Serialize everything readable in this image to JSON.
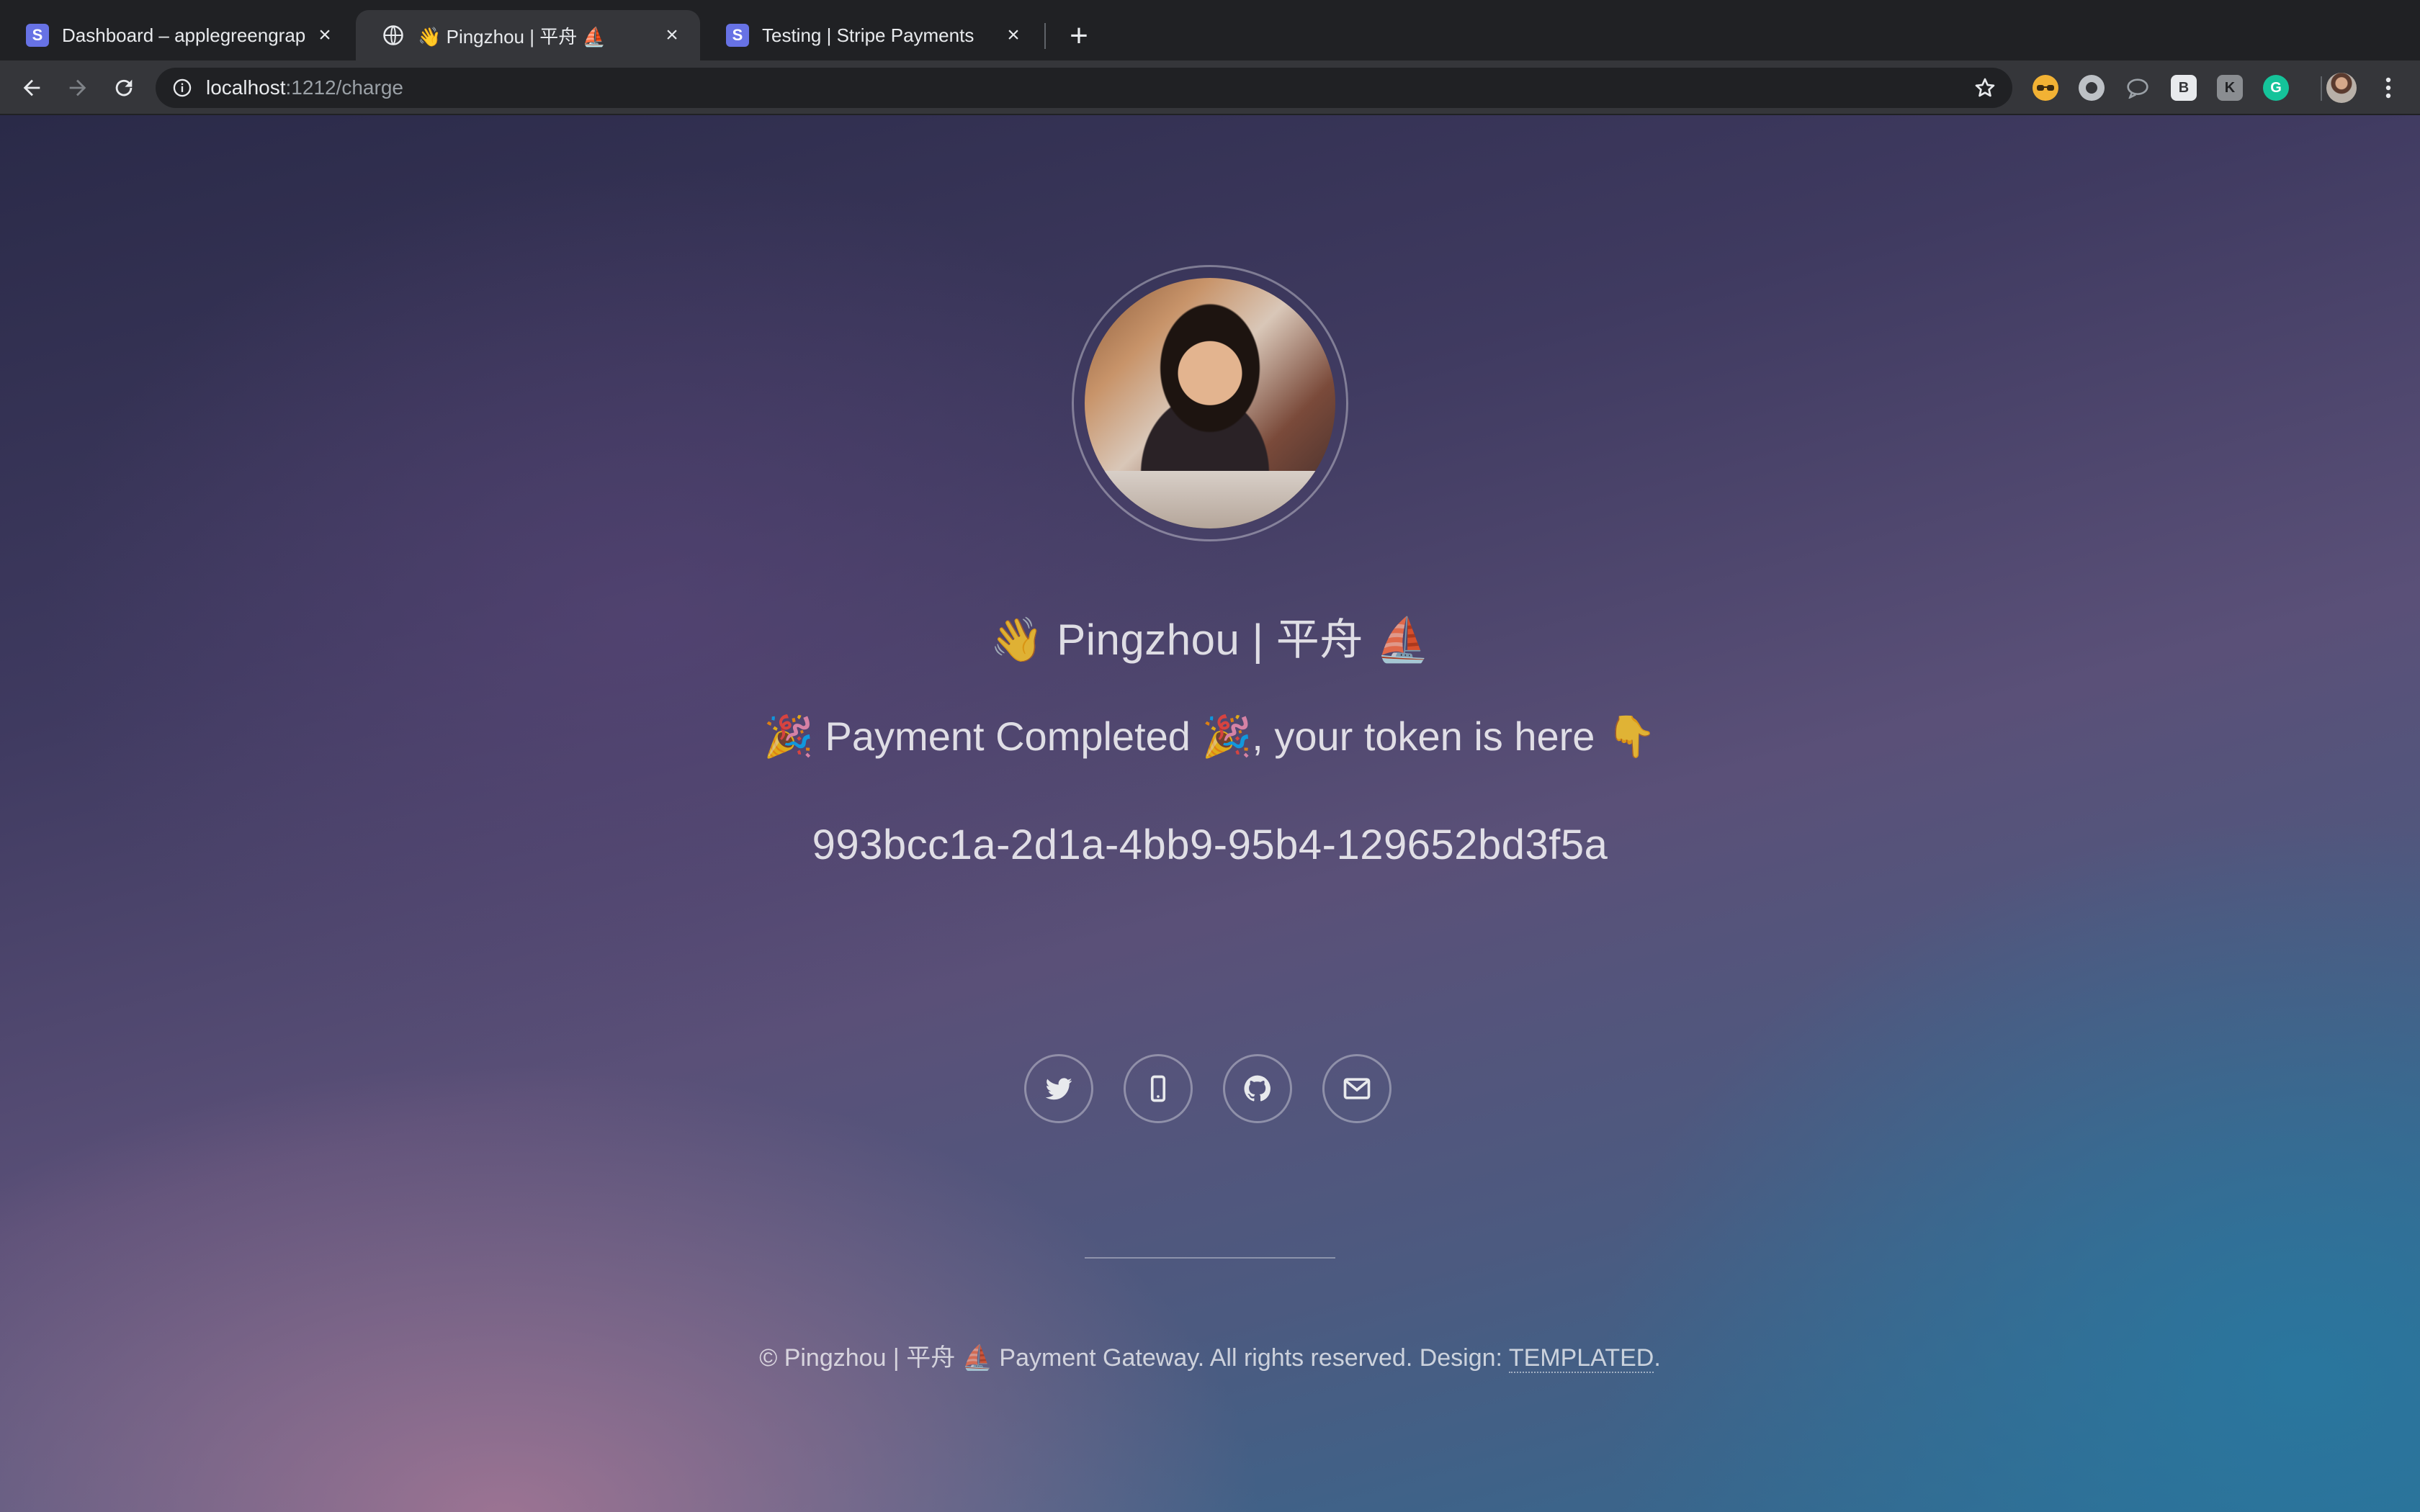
{
  "browser": {
    "tabs": [
      {
        "title": "Dashboard – applegreengrape",
        "icon": "stripe-icon",
        "active": false
      },
      {
        "title": "👋 Pingzhou | 平舟 ⛵",
        "icon": "globe-icon",
        "active": true
      },
      {
        "title": "Testing | Stripe Payments",
        "icon": "stripe-icon",
        "active": false
      }
    ],
    "new_tab": "+",
    "url": {
      "host": "localhost",
      "path": ":1212/charge"
    }
  },
  "page": {
    "title": "👋 Pingzhou | 平舟 ⛵",
    "message": "🎉 Payment Completed 🎉, your token is here 👇",
    "token": "993bcc1a-2d1a-4bb9-95b4-129652bd3f5a",
    "social": [
      {
        "name": "twitter-icon"
      },
      {
        "name": "phone-icon"
      },
      {
        "name": "github-icon"
      },
      {
        "name": "mail-icon"
      }
    ],
    "footer": {
      "prefix": "© Pingzhou | 平舟 ⛵ Payment Gateway. All rights reserved. Design: ",
      "link": "TEMPLATED",
      "suffix": "."
    }
  },
  "colors": {
    "chrome_dark": "#202124",
    "chrome_toolbar": "#35363a",
    "stripe": "#6772e5"
  }
}
